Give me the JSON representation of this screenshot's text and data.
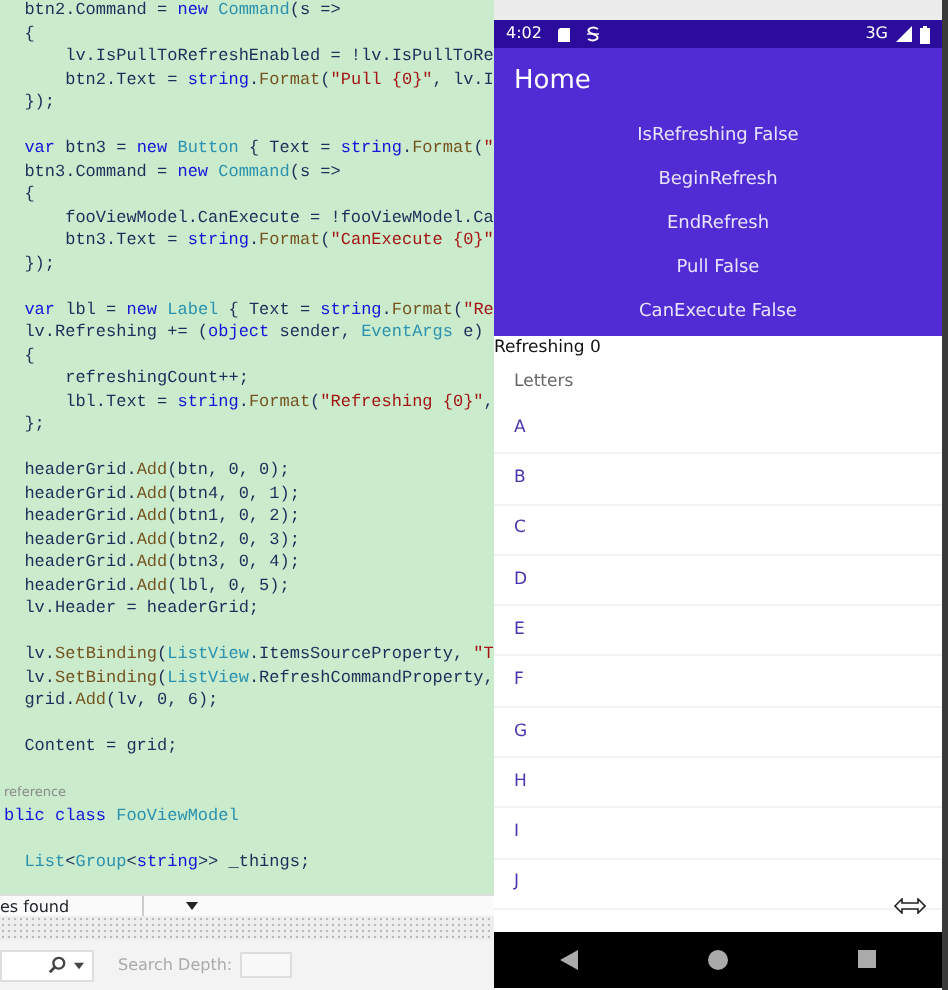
{
  "editor": {
    "lines": [
      {
        "kind": "code",
        "tokens": [
          {
            "text": "  btn2.Command = ",
            "kind": "plain"
          },
          {
            "text": "new ",
            "kind": "keyword"
          },
          {
            "text": "Command",
            "kind": "type"
          },
          {
            "text": "(s =>",
            "kind": "plain"
          }
        ]
      },
      {
        "kind": "code",
        "tokens": [
          {
            "text": "  {",
            "kind": "plain"
          }
        ]
      },
      {
        "kind": "code",
        "tokens": [
          {
            "text": "      lv.IsPullToRefreshEnabled = !lv.IsPullToRe",
            "kind": "plain"
          }
        ]
      },
      {
        "kind": "code",
        "tokens": [
          {
            "text": "      btn2.Text = ",
            "kind": "plain"
          },
          {
            "text": "string",
            "kind": "keyword"
          },
          {
            "text": ".",
            "kind": "plain"
          },
          {
            "text": "Format",
            "kind": "method"
          },
          {
            "text": "(",
            "kind": "plain"
          },
          {
            "text": "\"Pull {0}\"",
            "kind": "string"
          },
          {
            "text": ", lv.I",
            "kind": "plain"
          }
        ]
      },
      {
        "kind": "code",
        "tokens": [
          {
            "text": "  });",
            "kind": "plain"
          }
        ]
      },
      {
        "kind": "blank"
      },
      {
        "kind": "code",
        "tokens": [
          {
            "text": "  var",
            "kind": "keyword"
          },
          {
            "text": " btn3 = ",
            "kind": "plain"
          },
          {
            "text": "new ",
            "kind": "keyword"
          },
          {
            "text": "Button",
            "kind": "type"
          },
          {
            "text": " { Text = ",
            "kind": "plain"
          },
          {
            "text": "string",
            "kind": "keyword"
          },
          {
            "text": ".",
            "kind": "plain"
          },
          {
            "text": "Format",
            "kind": "method"
          },
          {
            "text": "(",
            "kind": "plain"
          },
          {
            "text": "\"",
            "kind": "string"
          }
        ]
      },
      {
        "kind": "code",
        "tokens": [
          {
            "text": "  btn3.Command = ",
            "kind": "plain"
          },
          {
            "text": "new ",
            "kind": "keyword"
          },
          {
            "text": "Command",
            "kind": "type"
          },
          {
            "text": "(s =>",
            "kind": "plain"
          }
        ]
      },
      {
        "kind": "code",
        "tokens": [
          {
            "text": "  {",
            "kind": "plain"
          }
        ]
      },
      {
        "kind": "code",
        "tokens": [
          {
            "text": "      fooViewModel.CanExecute = !fooViewModel.Ca",
            "kind": "plain"
          }
        ]
      },
      {
        "kind": "code",
        "tokens": [
          {
            "text": "      btn3.Text = ",
            "kind": "plain"
          },
          {
            "text": "string",
            "kind": "keyword"
          },
          {
            "text": ".",
            "kind": "plain"
          },
          {
            "text": "Format",
            "kind": "method"
          },
          {
            "text": "(",
            "kind": "plain"
          },
          {
            "text": "\"CanExecute {0}\"",
            "kind": "string"
          }
        ]
      },
      {
        "kind": "code",
        "tokens": [
          {
            "text": "  });",
            "kind": "plain"
          }
        ]
      },
      {
        "kind": "blank"
      },
      {
        "kind": "code",
        "tokens": [
          {
            "text": "  var",
            "kind": "keyword"
          },
          {
            "text": " lbl = ",
            "kind": "plain"
          },
          {
            "text": "new ",
            "kind": "keyword"
          },
          {
            "text": "Label",
            "kind": "type"
          },
          {
            "text": " { Text = ",
            "kind": "plain"
          },
          {
            "text": "string",
            "kind": "keyword"
          },
          {
            "text": ".",
            "kind": "plain"
          },
          {
            "text": "Format",
            "kind": "method"
          },
          {
            "text": "(",
            "kind": "plain"
          },
          {
            "text": "\"Re",
            "kind": "string"
          }
        ]
      },
      {
        "kind": "code",
        "tokens": [
          {
            "text": "  lv.Refreshing += (",
            "kind": "plain"
          },
          {
            "text": "object",
            "kind": "keyword"
          },
          {
            "text": " sender, ",
            "kind": "plain"
          },
          {
            "text": "EventArgs",
            "kind": "type"
          },
          {
            "text": " e)",
            "kind": "plain"
          }
        ]
      },
      {
        "kind": "code",
        "tokens": [
          {
            "text": "  {",
            "kind": "plain"
          }
        ]
      },
      {
        "kind": "code",
        "tokens": [
          {
            "text": "      refreshingCount++;",
            "kind": "plain"
          }
        ]
      },
      {
        "kind": "code",
        "tokens": [
          {
            "text": "      lbl.Text = ",
            "kind": "plain"
          },
          {
            "text": "string",
            "kind": "keyword"
          },
          {
            "text": ".",
            "kind": "plain"
          },
          {
            "text": "Format",
            "kind": "method"
          },
          {
            "text": "(",
            "kind": "plain"
          },
          {
            "text": "\"Refreshing {0}\"",
            "kind": "string"
          },
          {
            "text": ",",
            "kind": "plain"
          }
        ]
      },
      {
        "kind": "code",
        "tokens": [
          {
            "text": "  };",
            "kind": "plain"
          }
        ]
      },
      {
        "kind": "blank"
      },
      {
        "kind": "code",
        "tokens": [
          {
            "text": "  headerGrid.",
            "kind": "plain"
          },
          {
            "text": "Add",
            "kind": "method"
          },
          {
            "text": "(btn, 0, 0);",
            "kind": "plain"
          }
        ]
      },
      {
        "kind": "code",
        "tokens": [
          {
            "text": "  headerGrid.",
            "kind": "plain"
          },
          {
            "text": "Add",
            "kind": "method"
          },
          {
            "text": "(btn4, 0, 1);",
            "kind": "plain"
          }
        ]
      },
      {
        "kind": "code",
        "tokens": [
          {
            "text": "  headerGrid.",
            "kind": "plain"
          },
          {
            "text": "Add",
            "kind": "method"
          },
          {
            "text": "(btn1, 0, 2);",
            "kind": "plain"
          }
        ]
      },
      {
        "kind": "code",
        "tokens": [
          {
            "text": "  headerGrid.",
            "kind": "plain"
          },
          {
            "text": "Add",
            "kind": "method"
          },
          {
            "text": "(btn2, 0, 3);",
            "kind": "plain"
          }
        ]
      },
      {
        "kind": "code",
        "tokens": [
          {
            "text": "  headerGrid.",
            "kind": "plain"
          },
          {
            "text": "Add",
            "kind": "method"
          },
          {
            "text": "(btn3, 0, 4);",
            "kind": "plain"
          }
        ]
      },
      {
        "kind": "code",
        "tokens": [
          {
            "text": "  headerGrid.",
            "kind": "plain"
          },
          {
            "text": "Add",
            "kind": "method"
          },
          {
            "text": "(lbl, 0, 5);",
            "kind": "plain"
          }
        ]
      },
      {
        "kind": "code",
        "tokens": [
          {
            "text": "  lv.Header = headerGrid;",
            "kind": "plain"
          }
        ]
      },
      {
        "kind": "blank"
      },
      {
        "kind": "code",
        "tokens": [
          {
            "text": "  lv.",
            "kind": "plain"
          },
          {
            "text": "SetBinding",
            "kind": "method"
          },
          {
            "text": "(",
            "kind": "plain"
          },
          {
            "text": "ListView",
            "kind": "type"
          },
          {
            "text": ".ItemsSourceProperty, ",
            "kind": "plain"
          },
          {
            "text": "\"T",
            "kind": "string"
          }
        ]
      },
      {
        "kind": "code",
        "tokens": [
          {
            "text": "  lv.",
            "kind": "plain"
          },
          {
            "text": "SetBinding",
            "kind": "method"
          },
          {
            "text": "(",
            "kind": "plain"
          },
          {
            "text": "ListView",
            "kind": "type"
          },
          {
            "text": ".RefreshCommandProperty,",
            "kind": "plain"
          }
        ]
      },
      {
        "kind": "code",
        "tokens": [
          {
            "text": "  grid.",
            "kind": "plain"
          },
          {
            "text": "Add",
            "kind": "method"
          },
          {
            "text": "(lv, 0, 6);",
            "kind": "plain"
          }
        ]
      },
      {
        "kind": "blank"
      },
      {
        "kind": "code",
        "tokens": [
          {
            "text": "  Content = grid;",
            "kind": "plain"
          }
        ]
      },
      {
        "kind": "blank"
      },
      {
        "kind": "lens",
        "text": "reference"
      },
      {
        "kind": "code",
        "tokens": [
          {
            "text": "blic class ",
            "kind": "keyword"
          },
          {
            "text": "FooViewModel",
            "kind": "type"
          }
        ]
      },
      {
        "kind": "blank"
      },
      {
        "kind": "code",
        "tokens": [
          {
            "text": "  List",
            "kind": "type"
          },
          {
            "text": "<",
            "kind": "plain"
          },
          {
            "text": "Group",
            "kind": "type"
          },
          {
            "text": "<",
            "kind": "plain"
          },
          {
            "text": "string",
            "kind": "keyword"
          },
          {
            "text": ">> _things;",
            "kind": "plain"
          }
        ]
      }
    ]
  },
  "find_bar": {
    "results": "es found"
  },
  "search_bar": {
    "depth_label": "Search Depth:"
  },
  "emulator": {
    "status_bar": {
      "time": "4:02",
      "network": "3G"
    },
    "app_bar": {
      "title": "Home"
    },
    "buttons": [
      "IsRefreshing False",
      "BeginRefresh",
      "EndRefresh",
      "Pull False",
      "CanExecute False"
    ],
    "label": "Refreshing 0",
    "list": {
      "group": "Letters",
      "items": [
        "A",
        "B",
        "C",
        "D",
        "E",
        "F",
        "G",
        "H",
        "I",
        "J"
      ]
    }
  }
}
